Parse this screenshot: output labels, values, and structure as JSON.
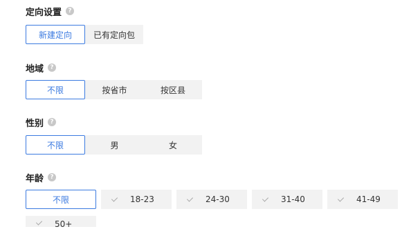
{
  "targeting": {
    "title": "定向设置",
    "new": "新建定向",
    "existing": "已有定向包"
  },
  "region": {
    "title": "地域",
    "options": [
      "不限",
      "按省市",
      "按区县"
    ]
  },
  "gender": {
    "title": "性别",
    "options": [
      "不限",
      "男",
      "女"
    ]
  },
  "age": {
    "title": "年龄",
    "options": [
      "不限",
      "18-23",
      "24-30",
      "31-40",
      "41-49",
      "50+"
    ]
  },
  "help_glyph": "?"
}
